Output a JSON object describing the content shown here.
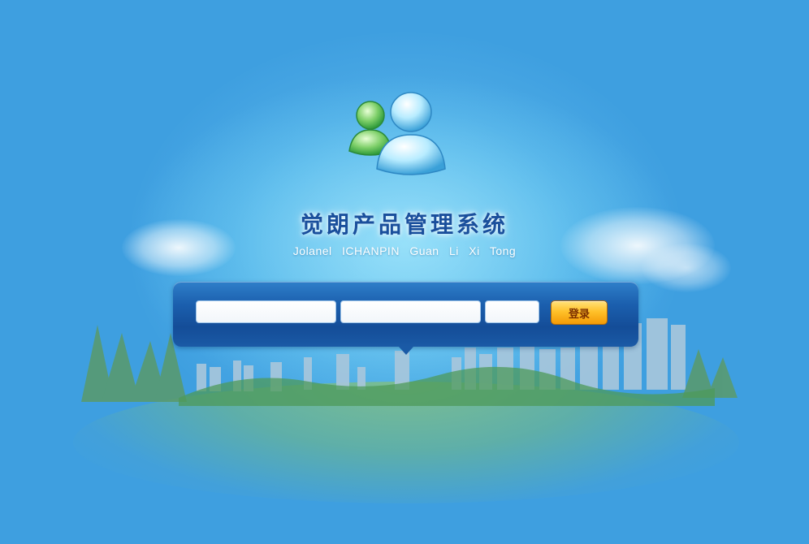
{
  "app": {
    "title": "觉朗产品管理系统",
    "subtitle": "Jolanel ICHANPIN Guan Li Xi Tong"
  },
  "login_form": {
    "username_value": "",
    "password_value": "",
    "captcha_value": "",
    "login_label": "登录"
  },
  "icons": {
    "logo": "users-icon"
  },
  "colors": {
    "background": "#3d9fe0",
    "title": "#1a4f9c",
    "bar": "#1b5fae",
    "login_button": "#ffc12a"
  }
}
